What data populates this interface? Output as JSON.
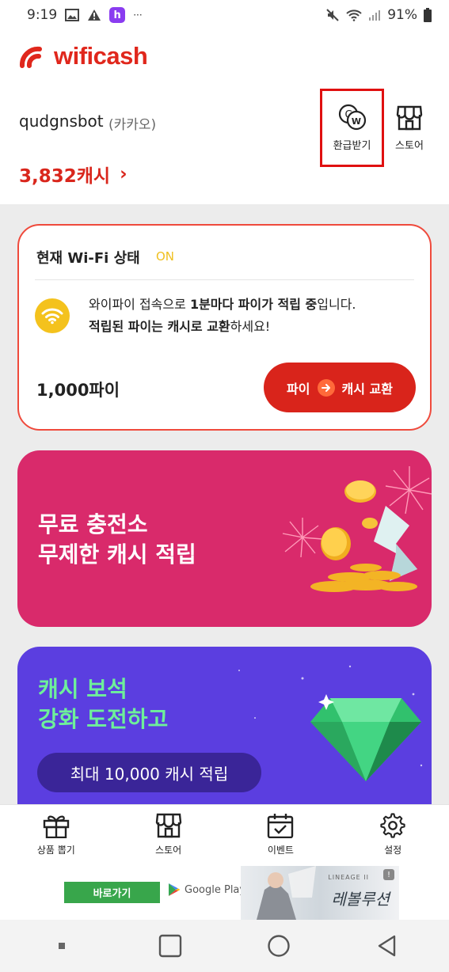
{
  "status_bar": {
    "time": "9:19",
    "battery": "91%",
    "more": "···",
    "badge_letter": "h"
  },
  "app": {
    "logo_text": "wificash",
    "brand_color": "#e0271c"
  },
  "profile": {
    "username": "qudgnsbot",
    "login_type": "(카카오)",
    "cash_amount": "3,832캐시",
    "cash_arrow": "›"
  },
  "header_actions": {
    "refund_label": "환급받기",
    "store_label": "스토어"
  },
  "wifi_card": {
    "title": "현재 Wi-Fi 상태",
    "status": "ON",
    "msg_line1_prefix": "와이파이 접속으로 ",
    "msg_line1_bold": "1분마다 파이가 적립 중",
    "msg_line1_suffix": "입니다.",
    "msg_line2_bold": "적립된 파이는 캐시로 교환",
    "msg_line2_suffix": "하세요!",
    "pie_amount": "1,000파이",
    "exchange_from": "파이",
    "exchange_to": "캐시 교환"
  },
  "banner_charge": {
    "line1": "무료 충전소",
    "line2": "무제한 캐시 적립"
  },
  "banner_gem": {
    "line1": "캐시 보석",
    "line2": "강화 도전하고",
    "pill": "최대 10,000 캐시 적립"
  },
  "bottom_nav": {
    "items": [
      {
        "label": "상품 뽑기",
        "icon": "gift-icon"
      },
      {
        "label": "스토어",
        "icon": "store-icon"
      },
      {
        "label": "이벤트",
        "icon": "calendar-check-icon"
      },
      {
        "label": "설정",
        "icon": "gear-icon"
      }
    ]
  },
  "ad": {
    "go_label": "바로가기",
    "store_label": "Google Play",
    "brand_small": "LINEAGE II",
    "brand_title": "레볼루션",
    "info": "!"
  }
}
